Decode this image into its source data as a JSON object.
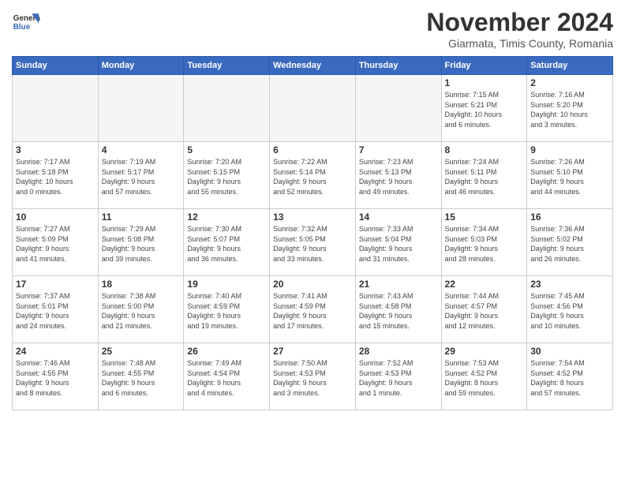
{
  "header": {
    "logo_line1": "General",
    "logo_line2": "Blue",
    "month_title": "November 2024",
    "location": "Giarmata, Timis County, Romania"
  },
  "weekdays": [
    "Sunday",
    "Monday",
    "Tuesday",
    "Wednesday",
    "Thursday",
    "Friday",
    "Saturday"
  ],
  "weeks": [
    [
      {
        "day": "",
        "info": ""
      },
      {
        "day": "",
        "info": ""
      },
      {
        "day": "",
        "info": ""
      },
      {
        "day": "",
        "info": ""
      },
      {
        "day": "",
        "info": ""
      },
      {
        "day": "1",
        "info": "Sunrise: 7:15 AM\nSunset: 5:21 PM\nDaylight: 10 hours\nand 6 minutes."
      },
      {
        "day": "2",
        "info": "Sunrise: 7:16 AM\nSunset: 5:20 PM\nDaylight: 10 hours\nand 3 minutes."
      }
    ],
    [
      {
        "day": "3",
        "info": "Sunrise: 7:17 AM\nSunset: 5:18 PM\nDaylight: 10 hours\nand 0 minutes."
      },
      {
        "day": "4",
        "info": "Sunrise: 7:19 AM\nSunset: 5:17 PM\nDaylight: 9 hours\nand 57 minutes."
      },
      {
        "day": "5",
        "info": "Sunrise: 7:20 AM\nSunset: 5:15 PM\nDaylight: 9 hours\nand 55 minutes."
      },
      {
        "day": "6",
        "info": "Sunrise: 7:22 AM\nSunset: 5:14 PM\nDaylight: 9 hours\nand 52 minutes."
      },
      {
        "day": "7",
        "info": "Sunrise: 7:23 AM\nSunset: 5:13 PM\nDaylight: 9 hours\nand 49 minutes."
      },
      {
        "day": "8",
        "info": "Sunrise: 7:24 AM\nSunset: 5:11 PM\nDaylight: 9 hours\nand 46 minutes."
      },
      {
        "day": "9",
        "info": "Sunrise: 7:26 AM\nSunset: 5:10 PM\nDaylight: 9 hours\nand 44 minutes."
      }
    ],
    [
      {
        "day": "10",
        "info": "Sunrise: 7:27 AM\nSunset: 5:09 PM\nDaylight: 9 hours\nand 41 minutes."
      },
      {
        "day": "11",
        "info": "Sunrise: 7:29 AM\nSunset: 5:08 PM\nDaylight: 9 hours\nand 39 minutes."
      },
      {
        "day": "12",
        "info": "Sunrise: 7:30 AM\nSunset: 5:07 PM\nDaylight: 9 hours\nand 36 minutes."
      },
      {
        "day": "13",
        "info": "Sunrise: 7:32 AM\nSunset: 5:05 PM\nDaylight: 9 hours\nand 33 minutes."
      },
      {
        "day": "14",
        "info": "Sunrise: 7:33 AM\nSunset: 5:04 PM\nDaylight: 9 hours\nand 31 minutes."
      },
      {
        "day": "15",
        "info": "Sunrise: 7:34 AM\nSunset: 5:03 PM\nDaylight: 9 hours\nand 28 minutes."
      },
      {
        "day": "16",
        "info": "Sunrise: 7:36 AM\nSunset: 5:02 PM\nDaylight: 9 hours\nand 26 minutes."
      }
    ],
    [
      {
        "day": "17",
        "info": "Sunrise: 7:37 AM\nSunset: 5:01 PM\nDaylight: 9 hours\nand 24 minutes."
      },
      {
        "day": "18",
        "info": "Sunrise: 7:38 AM\nSunset: 5:00 PM\nDaylight: 9 hours\nand 21 minutes."
      },
      {
        "day": "19",
        "info": "Sunrise: 7:40 AM\nSunset: 4:59 PM\nDaylight: 9 hours\nand 19 minutes."
      },
      {
        "day": "20",
        "info": "Sunrise: 7:41 AM\nSunset: 4:59 PM\nDaylight: 9 hours\nand 17 minutes."
      },
      {
        "day": "21",
        "info": "Sunrise: 7:43 AM\nSunset: 4:58 PM\nDaylight: 9 hours\nand 15 minutes."
      },
      {
        "day": "22",
        "info": "Sunrise: 7:44 AM\nSunset: 4:57 PM\nDaylight: 9 hours\nand 12 minutes."
      },
      {
        "day": "23",
        "info": "Sunrise: 7:45 AM\nSunset: 4:56 PM\nDaylight: 9 hours\nand 10 minutes."
      }
    ],
    [
      {
        "day": "24",
        "info": "Sunrise: 7:46 AM\nSunset: 4:55 PM\nDaylight: 9 hours\nand 8 minutes."
      },
      {
        "day": "25",
        "info": "Sunrise: 7:48 AM\nSunset: 4:55 PM\nDaylight: 9 hours\nand 6 minutes."
      },
      {
        "day": "26",
        "info": "Sunrise: 7:49 AM\nSunset: 4:54 PM\nDaylight: 9 hours\nand 4 minutes."
      },
      {
        "day": "27",
        "info": "Sunrise: 7:50 AM\nSunset: 4:53 PM\nDaylight: 9 hours\nand 3 minutes."
      },
      {
        "day": "28",
        "info": "Sunrise: 7:52 AM\nSunset: 4:53 PM\nDaylight: 9 hours\nand 1 minute."
      },
      {
        "day": "29",
        "info": "Sunrise: 7:53 AM\nSunset: 4:52 PM\nDaylight: 8 hours\nand 59 minutes."
      },
      {
        "day": "30",
        "info": "Sunrise: 7:54 AM\nSunset: 4:52 PM\nDaylight: 8 hours\nand 57 minutes."
      }
    ]
  ]
}
